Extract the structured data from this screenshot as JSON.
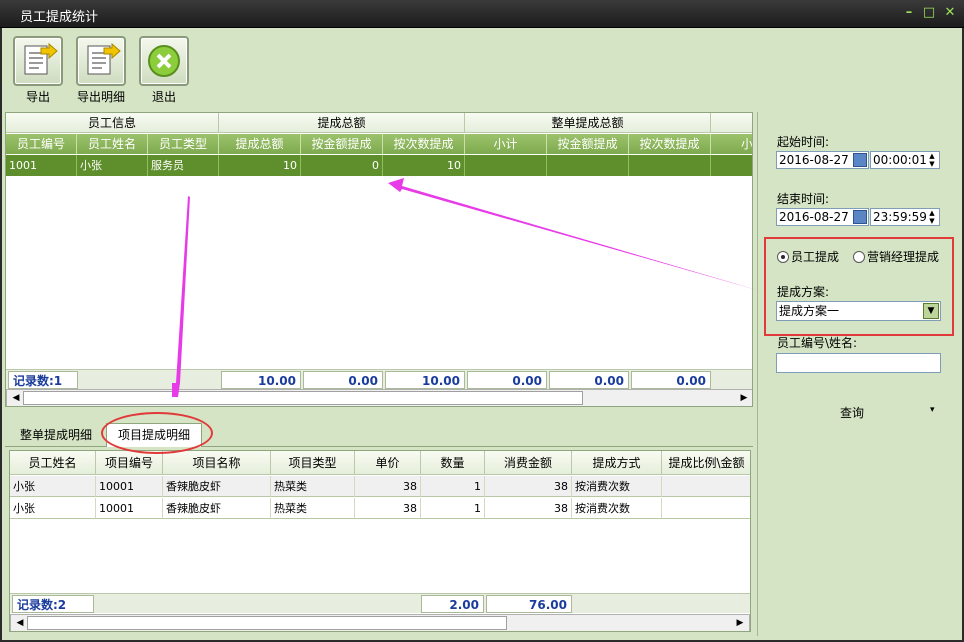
{
  "window": {
    "title": "员工提成统计",
    "min": "–",
    "max": "□",
    "close": "✕"
  },
  "toolbar": [
    {
      "label": "导出",
      "icon": "document-export-icon"
    },
    {
      "label": "导出明细",
      "icon": "document-export-detail-icon"
    },
    {
      "label": "退出",
      "icon": "exit-icon"
    }
  ],
  "top_grid": {
    "groups": [
      "员工信息",
      "提成总额",
      "整单提成总额"
    ],
    "columns": [
      "员工编号",
      "员工姓名",
      "员工类型",
      "提成总额",
      "按金额提成",
      "按次数提成",
      "小计",
      "按金额提成",
      "按次数提成",
      "小"
    ],
    "rows": [
      [
        "1001",
        "小张",
        "服务员",
        "10",
        "0",
        "10",
        "",
        "",
        "",
        ""
      ]
    ],
    "footer": {
      "count_label": "记录数:1",
      "sums": [
        "10.00",
        "0.00",
        "10.00",
        "0.00",
        "0.00",
        "0.00"
      ]
    }
  },
  "tabs": [
    {
      "label": "整单提成明细"
    },
    {
      "label": "项目提成明细"
    }
  ],
  "bottom_grid": {
    "columns": [
      "员工姓名",
      "项目编号",
      "项目名称",
      "项目类型",
      "单价",
      "数量",
      "消费金额",
      "提成方式",
      "提成比例\\金额"
    ],
    "rows": [
      [
        "小张",
        "10001",
        "香辣脆皮虾",
        "热菜类",
        "38",
        "1",
        "38",
        "按消费次数",
        ""
      ],
      [
        "小张",
        "10001",
        "香辣脆皮虾",
        "热菜类",
        "38",
        "1",
        "38",
        "按消费次数",
        ""
      ]
    ],
    "footer": {
      "count_label": "记录数:2",
      "sums": [
        "2.00",
        "76.00"
      ]
    }
  },
  "filters": {
    "start_label": "起始时间:",
    "start_date": "2016-08-27",
    "start_time": "00:00:01",
    "end_label": "结束时间:",
    "end_date": "2016-08-27",
    "end_time": "23:59:59",
    "radio1": "员工提成",
    "radio2": "营销经理提成",
    "scheme_label": "提成方案:",
    "scheme_value": "提成方案一",
    "emp_label": "员工编号\\姓名:",
    "emp_value": "",
    "query_label": "查询",
    "query_arrow": "▾"
  },
  "colors": {
    "header_green": "#7ea94e",
    "selected_row": "#5f8f2c",
    "annotation_red": "#e03a3a",
    "annotation_magenta": "#e83be8"
  }
}
